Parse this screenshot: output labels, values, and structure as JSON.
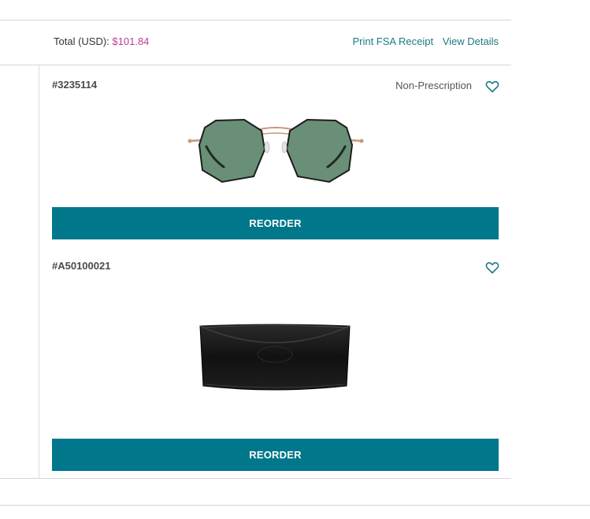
{
  "order_summary": {
    "total_label": "Total (USD):",
    "total_amount": "$101.84",
    "print_fsa_label": "Print FSA Receipt",
    "view_details_label": "View Details"
  },
  "items": [
    {
      "sku": "#3235114",
      "lens_type": "Non-Prescription",
      "image_icon": "sunglasses-image",
      "reorder_label": "REORDER"
    },
    {
      "sku": "#A50100021",
      "lens_type": "",
      "image_icon": "glasses-case-image",
      "reorder_label": "REORDER"
    }
  ],
  "colors": {
    "accent": "#00778b",
    "link": "#1a7a84",
    "price": "#c0399b",
    "divider": "#d6d6d6"
  }
}
